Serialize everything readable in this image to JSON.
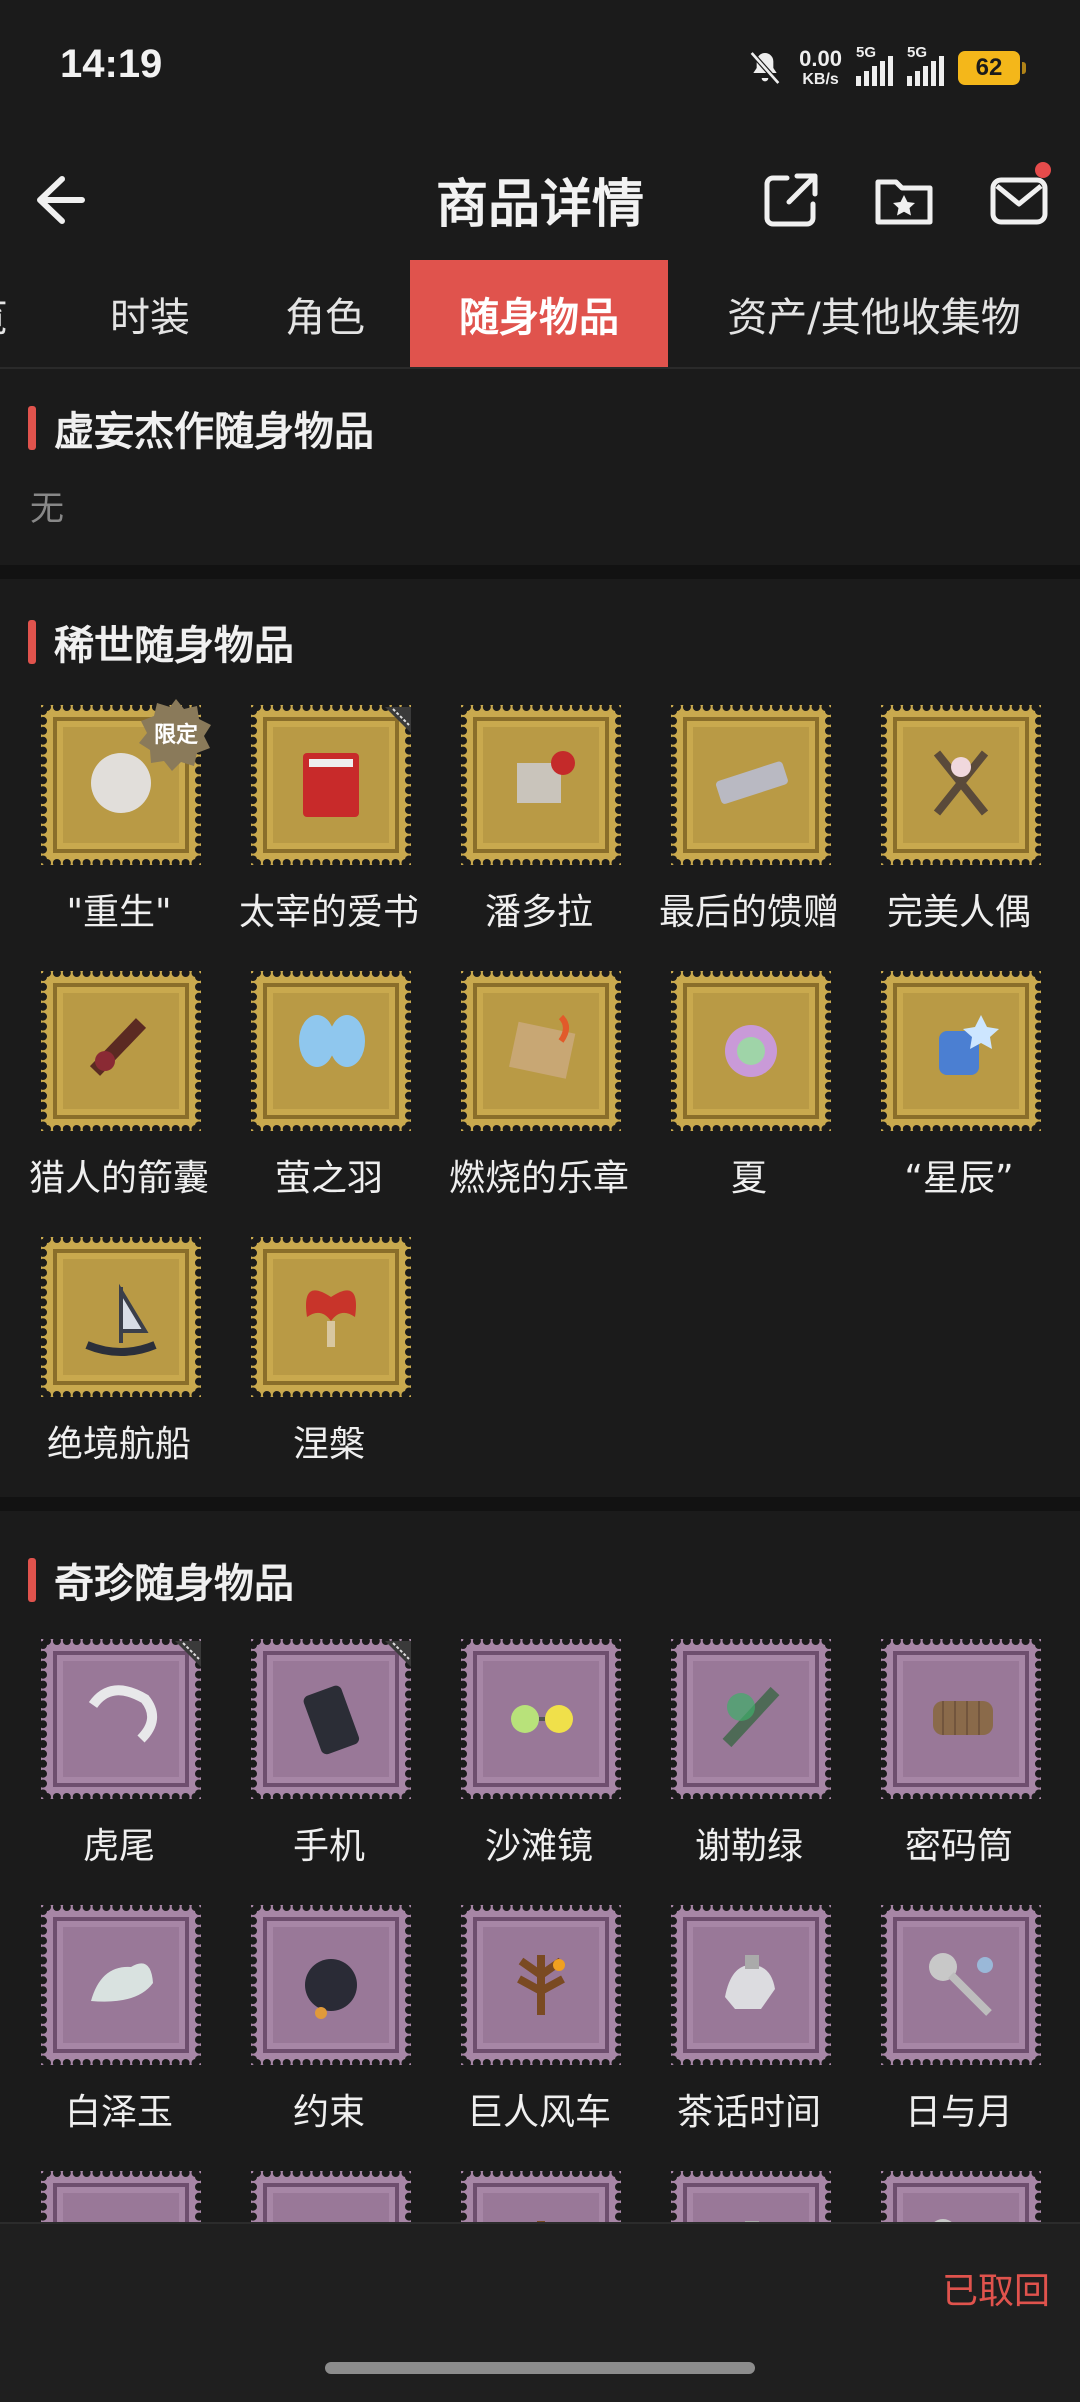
{
  "status": {
    "time": "14:19",
    "net_value": "0.00",
    "net_unit": "KB/s",
    "sim1": "5G",
    "sim2": "5G",
    "battery": "62"
  },
  "header": {
    "title": "商品详情"
  },
  "tabs": [
    {
      "label": "览"
    },
    {
      "label": "时装"
    },
    {
      "label": "角色"
    },
    {
      "label": "随身物品",
      "active": true
    },
    {
      "label": "资产/其他收集物"
    }
  ],
  "sections": {
    "masterpiece": {
      "title": "虚妄杰作随身物品",
      "empty_text": "无"
    },
    "rare": {
      "title": "稀世随身物品",
      "items": [
        {
          "label": "\"重生\"",
          "badge": "限定"
        },
        {
          "label": "太宰的爱书"
        },
        {
          "label": "潘多拉"
        },
        {
          "label": "最后的馈赠"
        },
        {
          "label": "完美人偶"
        },
        {
          "label": "猎人的箭囊"
        },
        {
          "label": "萤之羽"
        },
        {
          "label": "燃烧的乐章"
        },
        {
          "label": "夏"
        },
        {
          "label": "“星辰”"
        },
        {
          "label": "绝境航船"
        },
        {
          "label": "涅槃"
        }
      ]
    },
    "treasure": {
      "title": "奇珍随身物品",
      "items": [
        {
          "label": "虎尾"
        },
        {
          "label": "手机"
        },
        {
          "label": "沙滩镜"
        },
        {
          "label": "谢勒绿"
        },
        {
          "label": "密码筒"
        },
        {
          "label": "白泽玉"
        },
        {
          "label": "约束"
        },
        {
          "label": "巨人风车"
        },
        {
          "label": "茶话时间"
        },
        {
          "label": "日与月"
        }
      ]
    }
  },
  "bottom": {
    "action_text": "已取回"
  },
  "colors": {
    "accent": "#e0534d",
    "gold_stamp": "#c9a94e",
    "purple_stamp": "#a786a6",
    "background": "#1b1b1b"
  },
  "icons": [
    "back-arrow-icon",
    "share-icon",
    "favorite-folder-icon",
    "mail-icon",
    "bell-off-icon"
  ]
}
